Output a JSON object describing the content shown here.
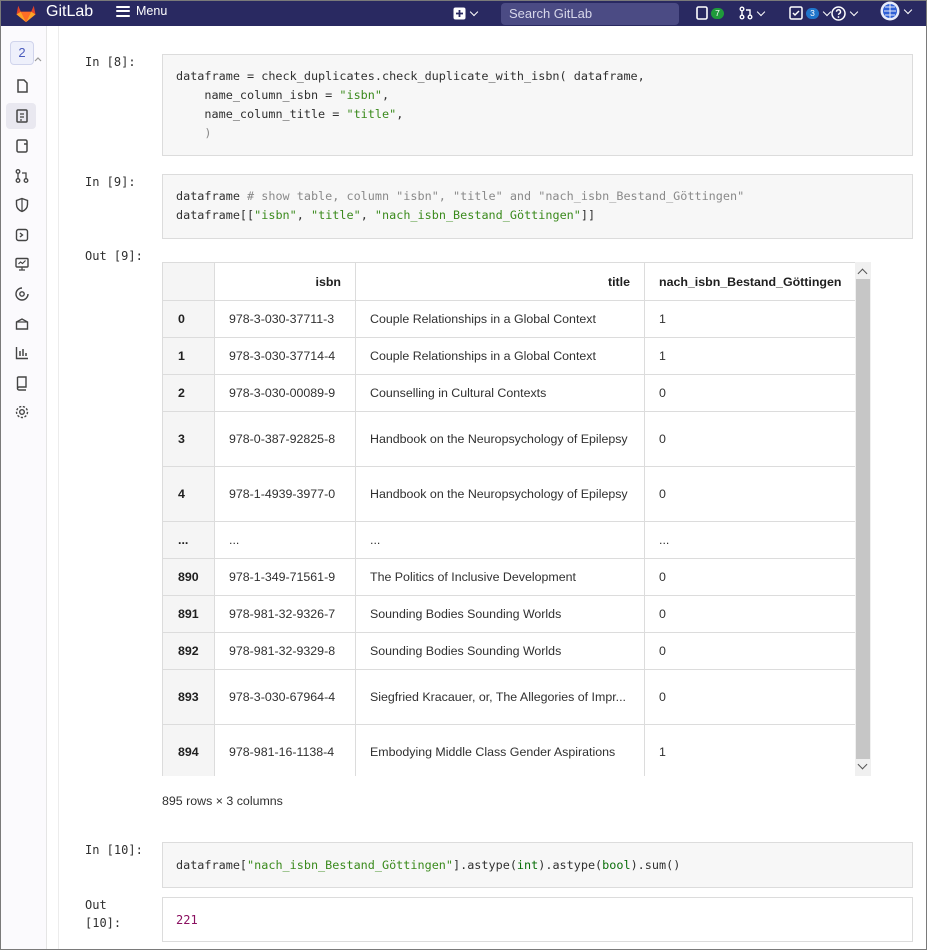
{
  "header": {
    "brand": "GitLab",
    "menu_label": "Menu",
    "search_placeholder": "Search GitLab",
    "issues_count": "7",
    "todos_count": "3",
    "colors": {
      "bar": "#292961",
      "issues_badge": "#1f9a3b",
      "todos_badge": "#1f75cb"
    }
  },
  "sidebar": {
    "project_initial": "2",
    "icons": [
      "project-overview-icon",
      "repository-icon",
      "issues-icon",
      "merge-requests-icon",
      "security-icon",
      "deployments-icon",
      "monitor-icon",
      "infrastructure-icon",
      "packages-icon",
      "analytics-icon",
      "wiki-icon",
      "settings-icon"
    ]
  },
  "cells": [
    {
      "prompt": "In [8]:",
      "code": "dataframe = check_duplicates.check_duplicate_with_isbn( dataframe,\n    name_column_isbn = \"isbn\",\n    name_column_title = \"title\",\n    )"
    },
    {
      "prompt": "In [9]:",
      "code": "dataframe # show table, column \"isbn\", \"title\" and \"nach_isbn_Bestand_Göttingen\"\ndataframe[[\"isbn\", \"title\", \"nach_isbn_Bestand_Göttingen\"]]"
    },
    {
      "prompt": "In [10]:",
      "code": "dataframe[\"nach_isbn_Bestand_Göttingen\"].astype(int).astype(bool).sum()"
    }
  ],
  "out9": {
    "prompt": "Out [9]:",
    "columns": [
      "",
      "isbn",
      "title",
      "nach_isbn_Bestand_Göttingen"
    ],
    "rows": [
      [
        "0",
        "978-3-030-37711-3",
        "Couple Relationships in a Global Context",
        "1"
      ],
      [
        "1",
        "978-3-030-37714-4",
        "Couple Relationships in a Global Context",
        "1"
      ],
      [
        "2",
        "978-3-030-00089-9",
        "Counselling in Cultural Contexts",
        "0"
      ],
      [
        "3",
        "978-0-387-92825-8",
        "Handbook on the Neuropsychology of Epilepsy",
        "0"
      ],
      [
        "4",
        "978-1-4939-3977-0",
        "Handbook on the Neuropsychology of Epilepsy",
        "0"
      ],
      [
        "...",
        "...",
        "...",
        "..."
      ],
      [
        "890",
        "978-1-349-71561-9",
        "The Politics of Inclusive Development",
        "0"
      ],
      [
        "891",
        "978-981-32-9326-7",
        "Sounding Bodies Sounding Worlds",
        "0"
      ],
      [
        "892",
        "978-981-32-9329-8",
        "Sounding Bodies Sounding Worlds",
        "0"
      ],
      [
        "893",
        "978-3-030-67964-4",
        "Siegfried Kracauer, or, The Allegories of Impr...",
        "0"
      ],
      [
        "894",
        "978-981-16-1138-4",
        "Embodying Middle Class Gender Aspirations",
        "1"
      ]
    ],
    "shape": "895 rows × 3 columns"
  },
  "out10": {
    "prompt_line1": "Out",
    "prompt_line2": "[10]:",
    "value": "221"
  }
}
